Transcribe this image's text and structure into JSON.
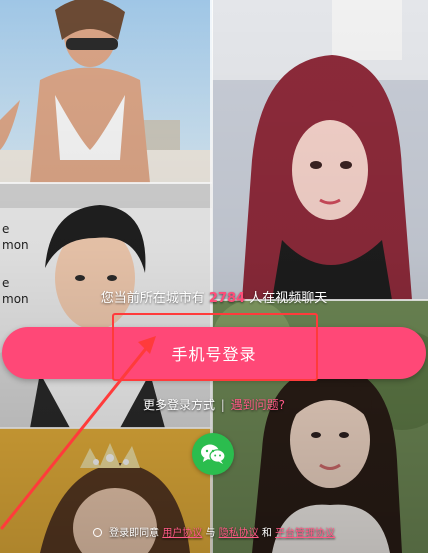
{
  "online_banner": {
    "prefix": "您当前所在城市有",
    "count": "2784",
    "suffix": "人在视频聊天"
  },
  "login": {
    "phone_login_label": "手机号登录",
    "more_methods_label": "更多登录方式",
    "separator": "|",
    "login_problem_label": "遇到问题?",
    "wechat_icon": "wechat-icon"
  },
  "agreement": {
    "prefix": "登录即同意",
    "user_agreement": "用户协议",
    "and1": "与",
    "privacy_policy": "隐私协议",
    "and2": "和",
    "platform_rules": "平台管理协议"
  },
  "photos": {
    "top_left_sign_lines": [
      "e",
      "mon",
      "e",
      "mon"
    ]
  },
  "colors": {
    "accent": "#ff4877",
    "link": "#ff5a86",
    "annotation": "#ff3b3b",
    "wechat": "#2bbd4e"
  }
}
